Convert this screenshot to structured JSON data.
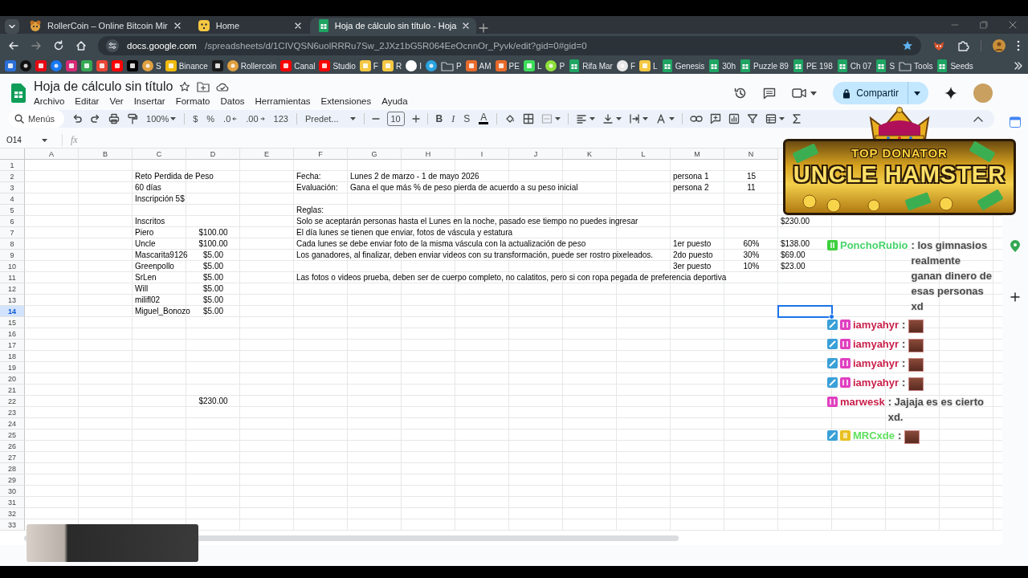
{
  "browser": {
    "tabs": [
      {
        "kind": "hamster",
        "title": "RollerCoin – Online Bitcoin Mir",
        "selected": false
      },
      {
        "kind": "face",
        "title": "Home",
        "selected": false
      },
      {
        "kind": "sheets",
        "title": "Hoja de cálculo sin título - Hoja",
        "selected": true
      }
    ],
    "address": {
      "host": "docs.google.com",
      "path": "/spreadsheets/d/1CIVQSN6uolRRRu7Sw_2JXz1bG5R064EeOcnnOr_Pyvk/edit?gid=0#gid=0"
    },
    "bookmarks": [
      {
        "kind": "square",
        "color": "#2a6fd6"
      },
      {
        "kind": "circle",
        "color": "#111111"
      },
      {
        "kind": "square",
        "color": "#e50914"
      },
      {
        "kind": "circle",
        "color": "#1877f2"
      },
      {
        "kind": "square",
        "color": "#d62976"
      },
      {
        "kind": "square",
        "color": "#34a853"
      },
      {
        "kind": "square",
        "color": "#ea4335"
      },
      {
        "kind": "square",
        "color": "#ff0000"
      },
      {
        "kind": "square",
        "color": "#000000"
      },
      {
        "kind": "circle",
        "color": "#e0a040",
        "label": "S"
      },
      {
        "kind": "square",
        "color": "#f0b90b",
        "label": "Binance"
      },
      {
        "kind": "square",
        "color": "#1a1a1a"
      },
      {
        "kind": "circle",
        "color": "#e0a040",
        "label": "Rollercoin"
      },
      {
        "kind": "square",
        "color": "#ff0000",
        "label": "Canal"
      },
      {
        "kind": "square",
        "color": "#ff0000",
        "label": "Studio"
      },
      {
        "kind": "square",
        "color": "#f5c842",
        "label": "F"
      },
      {
        "kind": "square",
        "color": "#f5c842",
        "label": "R"
      },
      {
        "kind": "circle",
        "color": "#ffffff",
        "label": "I"
      },
      {
        "kind": "circle",
        "color": "#2aa3e0"
      },
      {
        "kind": "folder",
        "label": "P"
      },
      {
        "kind": "square",
        "color": "#e86a2a",
        "label": "AM"
      },
      {
        "kind": "square",
        "color": "#e86a2a",
        "label": "PE"
      },
      {
        "kind": "square",
        "color": "#3ddc5a",
        "label": "L"
      },
      {
        "kind": "circle",
        "color": "#8ee03a",
        "label": "P"
      },
      {
        "kind": "sheets",
        "label": "Rifa Mar"
      },
      {
        "kind": "circle",
        "color": "#e8e8e8",
        "label": "F"
      },
      {
        "kind": "square",
        "color": "#f5c842",
        "label": "L"
      },
      {
        "kind": "sheets",
        "label": "Genesis"
      },
      {
        "kind": "sheets",
        "label": "30h"
      },
      {
        "kind": "sheets",
        "label": "Puzzle 89"
      },
      {
        "kind": "sheets",
        "label": "PE 198"
      },
      {
        "kind": "sheets",
        "label": "Ch 07"
      },
      {
        "kind": "sheets",
        "label": "S"
      },
      {
        "kind": "folder",
        "label": "Tools"
      },
      {
        "kind": "sheets",
        "label": "Seeds"
      }
    ]
  },
  "sheet": {
    "title": "Hoja de cálculo sin título",
    "menus": [
      "Archivo",
      "Editar",
      "Ver",
      "Insertar",
      "Formato",
      "Datos",
      "Herramientas",
      "Extensiones",
      "Ayuda"
    ],
    "share_button": "Compartir",
    "toolbar": {
      "search": "Menús",
      "zoom": "100%",
      "currency": "$",
      "percent": "%",
      "decimal_less": ".0",
      "decimal_more": ".00",
      "format": "123",
      "font": "Predet...",
      "font_size": "10",
      "bold": "B",
      "italic": "I",
      "strikethrough": "S",
      "text_color": "A"
    },
    "name_box": "O14",
    "formula_label": "fx",
    "columns": [
      "A",
      "B",
      "C",
      "D",
      "E",
      "F",
      "G",
      "H",
      "I",
      "J",
      "K",
      "L",
      "M",
      "N"
    ],
    "rows": [
      {
        "number": "1"
      },
      {
        "number": "2",
        "cells": {
          "C": {
            "text": "Reto Perdida de Peso",
            "selected": false
          },
          "F": {
            "text": "Fecha:",
            "selected": false
          },
          "G": {
            "text": "Lunes 2 de marzo - 1 de mayo 2026",
            "selected": false
          },
          "M": {
            "text": "persona 1",
            "selected": false
          },
          "N": {
            "text": "15",
            "selected": false
          }
        }
      },
      {
        "number": "3",
        "cells": {
          "C": {
            "text": "60 días",
            "selected": false
          },
          "F": {
            "text": "Evaluación:",
            "selected": false
          },
          "G": {
            "text": "Gana el que más % de peso pierda de acuerdo a su peso inicial",
            "selected": false
          },
          "M": {
            "text": "persona 2",
            "selected": false
          },
          "N": {
            "text": "11",
            "selected": false
          }
        }
      },
      {
        "number": "4",
        "cells": {
          "C": {
            "text": "Inscripción 5$",
            "selected": false
          }
        }
      },
      {
        "number": "5",
        "cells": {
          "F": {
            "text": "Reglas:",
            "selected": false
          }
        }
      },
      {
        "number": "6",
        "cells": {
          "C": {
            "text": "Inscritos",
            "selected": false
          },
          "F": {
            "text": "Solo se aceptarán personas hasta el Lunes en la noche, pasado ese tiempo no puedes ingresar",
            "selected": false
          },
          "O": {
            "text": "$230.00",
            "selected": false
          }
        }
      },
      {
        "number": "7",
        "cells": {
          "C": {
            "text": "Piero",
            "selected": false
          },
          "D": {
            "text": "$100.00",
            "selected": false
          },
          "F": {
            "text": "El día lunes se tienen que enviar, fotos de váscula y estatura",
            "selected": false
          }
        }
      },
      {
        "number": "8",
        "cells": {
          "C": {
            "text": "Uncle",
            "selected": false
          },
          "D": {
            "text": "$100.00",
            "selected": false
          },
          "F": {
            "text": "Cada lunes se debe enviar foto de la misma váscula con la actualización de peso",
            "selected": false
          },
          "M": {
            "text": "1er puesto",
            "selected": false
          },
          "N": {
            "text": "60%",
            "selected": false
          },
          "O": {
            "text": "$138.00",
            "selected": false
          }
        }
      },
      {
        "number": "9",
        "cells": {
          "C": {
            "text": "Mascarita9126",
            "selected": false
          },
          "D": {
            "text": "$5.00",
            "selected": false
          },
          "F": {
            "text": "Los ganadores, al finalizar, deben enviar videos con su transformación, puede ser rostro pixeleados.",
            "selected": false
          },
          "M": {
            "text": "2do puesto",
            "selected": false
          },
          "N": {
            "text": "30%",
            "selected": false
          },
          "O": {
            "text": "$69.00",
            "selected": false
          }
        }
      },
      {
        "number": "10",
        "cells": {
          "C": {
            "text": "Greenpollo",
            "selected": false
          },
          "D": {
            "text": "$5.00",
            "selected": false
          },
          "M": {
            "text": "3er puesto",
            "selected": false
          },
          "N": {
            "text": "10%",
            "selected": false
          },
          "O": {
            "text": "$23.00",
            "selected": false
          }
        }
      },
      {
        "number": "11",
        "cells": {
          "C": {
            "text": "SrLen",
            "selected": false
          },
          "D": {
            "text": "$5.00",
            "selected": false
          },
          "F": {
            "text": "Las fotos o videos prueba, deben ser de cuerpo completo, no calatitos, pero si con ropa pegada de preferencia deportiva",
            "selected": false
          }
        }
      },
      {
        "number": "12",
        "cells": {
          "C": {
            "text": "Will",
            "selected": false
          },
          "D": {
            "text": "$5.00",
            "selected": false
          }
        }
      },
      {
        "number": "13",
        "cells": {
          "C": {
            "text": "milifl02",
            "selected": false
          },
          "D": {
            "text": "$5.00",
            "selected": false
          }
        }
      },
      {
        "number": "14",
        "cells": {
          "C": {
            "text": "Miguel_Bonozo",
            "selected": false
          },
          "D": {
            "text": "$5.00",
            "selected": false
          },
          "O": {
            "selected": true
          }
        }
      },
      {
        "number": "15"
      },
      {
        "number": "16"
      },
      {
        "number": "17"
      },
      {
        "number": "18"
      },
      {
        "number": "19"
      },
      {
        "number": "20"
      },
      {
        "number": "21"
      },
      {
        "number": "22",
        "cells": {
          "D": {
            "text": "$230.00",
            "selected": false
          }
        }
      },
      {
        "number": "23"
      },
      {
        "number": "24"
      },
      {
        "number": "25"
      },
      {
        "number": "26"
      },
      {
        "number": "27"
      },
      {
        "number": "28"
      },
      {
        "number": "29"
      },
      {
        "number": "30"
      },
      {
        "number": "31"
      },
      {
        "number": "32"
      },
      {
        "number": "33"
      }
    ]
  },
  "banner": {
    "subtitle": "TOP DONATOR",
    "name": "UNCLE HAMSTER"
  },
  "chat": {
    "messages": [
      {
        "badges": [
          {
            "kind": "green"
          }
        ],
        "user": "PonchoRubio",
        "color": "#46d46a",
        "separator": ":",
        "text": "los gimnasios realmente ganan dinero de esas personas xd"
      },
      {
        "badges": [
          {
            "kind": "pencil"
          },
          {
            "kind": "pink"
          }
        ],
        "user": "iamyahyr",
        "color": "#c8204a",
        "separator": ":",
        "emote": true
      },
      {
        "badges": [
          {
            "kind": "pencil"
          },
          {
            "kind": "pink"
          }
        ],
        "user": "iamyahyr",
        "color": "#c8204a",
        "separator": ":",
        "emote": true
      },
      {
        "badges": [
          {
            "kind": "pencil"
          },
          {
            "kind": "pink"
          }
        ],
        "user": "iamyahyr",
        "color": "#c8204a",
        "separator": ":",
        "emote": true
      },
      {
        "badges": [
          {
            "kind": "pencil"
          },
          {
            "kind": "pink"
          }
        ],
        "user": "iamyahyr",
        "color": "#c8204a",
        "separator": ":",
        "emote": true
      },
      {
        "badges": [
          {
            "kind": "pink"
          }
        ],
        "user": "marwesk",
        "color": "#c8204a",
        "separator": ":",
        "text": "Jajaja es es cierto xd."
      },
      {
        "badges": [
          {
            "kind": "pencil"
          },
          {
            "kind": "gold"
          }
        ],
        "user": "MRCxde",
        "color": "#5ee05e",
        "separator": ":",
        "emote": true
      }
    ]
  }
}
